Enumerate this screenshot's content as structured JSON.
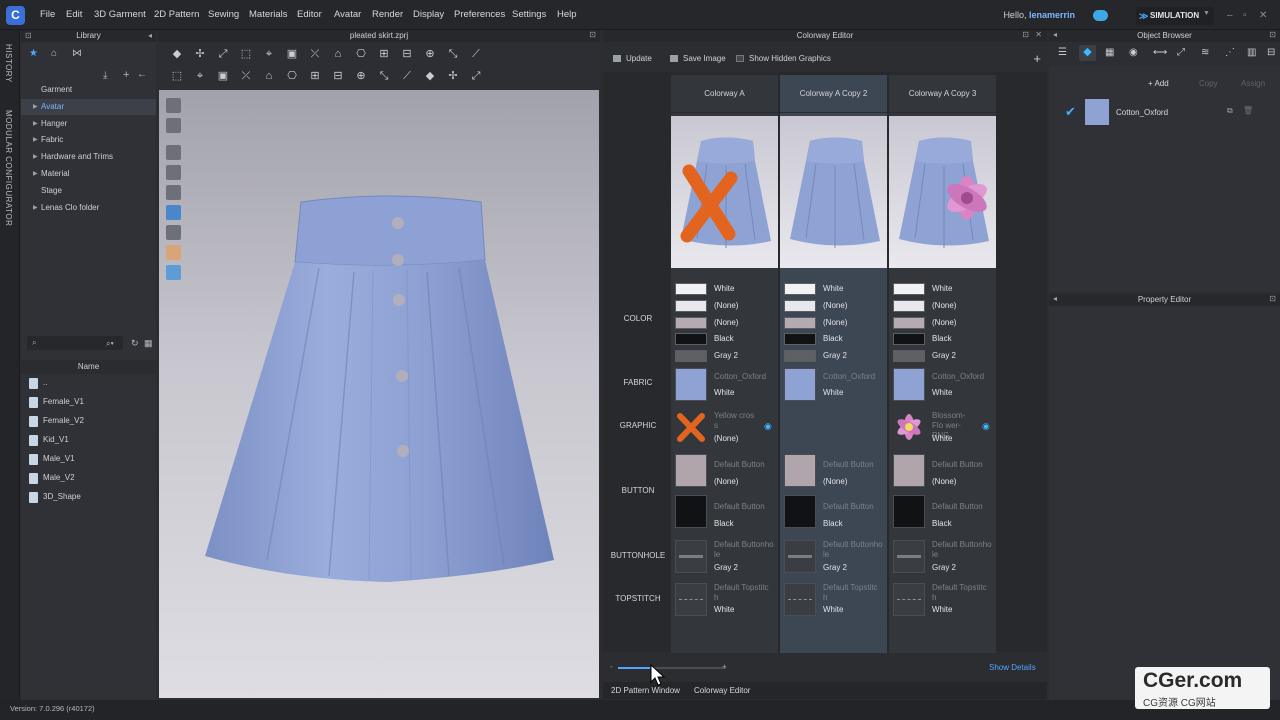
{
  "app": {
    "menus": [
      "File",
      "Edit",
      "3D Garment",
      "2D Pattern",
      "Sewing",
      "Materials",
      "Editor",
      "Avatar",
      "Render",
      "Display",
      "Preferences",
      "Settings",
      "Help"
    ],
    "greeting": "Hello,",
    "username": "lenamerrin",
    "mode": "SIMULATION",
    "logo": "C"
  },
  "side_tabs": [
    "HISTORY",
    "MODULAR CONFIGURATOR"
  ],
  "library": {
    "title": "Library",
    "tree": [
      {
        "label": "Garment",
        "arrow": false,
        "selected": false
      },
      {
        "label": "Avatar",
        "arrow": true,
        "selected": true
      },
      {
        "label": "Hanger",
        "arrow": true,
        "selected": false
      },
      {
        "label": "Fabric",
        "arrow": true,
        "selected": false
      },
      {
        "label": "Hardware and Trims",
        "arrow": true,
        "selected": false
      },
      {
        "label": "Material",
        "arrow": true,
        "selected": false
      },
      {
        "label": "Stage",
        "arrow": false,
        "selected": false
      },
      {
        "label": "Lenas Clo folder",
        "arrow": true,
        "selected": false
      }
    ],
    "search_placeholder": "Q",
    "name_header": "Name",
    "files": [
      "..",
      "Female_V1",
      "Female_V2",
      "Kid_V1",
      "Male_V1",
      "Male_V2",
      "3D_Shape"
    ]
  },
  "viewport": {
    "title": "pleated skirt.zprj"
  },
  "colorway": {
    "title": "Colorway Editor",
    "actions": [
      "Update",
      "Save Image",
      "Show Hidden Graphics"
    ],
    "columns": [
      {
        "name": "Colorway A",
        "graphic": "cross",
        "colors": [
          "White",
          "(None)",
          "(None)",
          "Black",
          "Gray 2"
        ],
        "fabric_name": "Cotton_Oxford",
        "fabric_color": "White",
        "graphic_name": "Yellow cros s",
        "graphic_color": "(None)",
        "button1_name": "Default Button",
        "button1_color": "(None)",
        "button2_name": "Default Button",
        "button2_color": "Black",
        "buttonhole_name": "Default Buttonho le",
        "buttonhole_color": "Gray 2",
        "topstitch_name": "Default Topstitc h",
        "topstitch_color": "White"
      },
      {
        "name": "Colorway A Copy 2",
        "graphic": "none",
        "colors": [
          "White",
          "(None)",
          "(None)",
          "Black",
          "Gray 2"
        ],
        "fabric_name": "Cotton_Oxford",
        "fabric_color": "White",
        "graphic_name": "",
        "graphic_color": "",
        "button1_name": "Default Button",
        "button1_color": "(None)",
        "button2_name": "Default Button",
        "button2_color": "Black",
        "buttonhole_name": "Default Buttonho le",
        "buttonhole_color": "Gray 2",
        "topstitch_name": "Default Topstitc h",
        "topstitch_color": "White"
      },
      {
        "name": "Colorway A Copy 3",
        "graphic": "flower",
        "colors": [
          "White",
          "(None)",
          "(None)",
          "Black",
          "Gray 2"
        ],
        "fabric_name": "Cotton_Oxford",
        "fabric_color": "White",
        "graphic_name": "Blossom-Flo wer-PNG",
        "graphic_color": "White",
        "button1_name": "Default Button",
        "button1_color": "(None)",
        "button2_name": "Default Button",
        "button2_color": "Black",
        "buttonhole_name": "Default Buttonho le",
        "buttonhole_color": "Gray 2",
        "topstitch_name": "Default Topstitc h",
        "topstitch_color": "White"
      }
    ],
    "row_labels": [
      "COLOR",
      "FABRIC",
      "GRAPHIC",
      "BUTTON",
      "BUTTONHOLE",
      "TOPSTITCH"
    ],
    "zoom_minus": "-",
    "zoom_plus": "+",
    "show_details": "Show Details"
  },
  "bottom_tabs": [
    "2D Pattern Window",
    "Colorway Editor"
  ],
  "object_browser": {
    "title": "Object Browser",
    "add": "+ Add",
    "copy": "Copy",
    "assign": "Assign",
    "items": [
      {
        "name": "Cotton_Oxford",
        "checked": true
      }
    ]
  },
  "property_editor": {
    "title": "Property Editor"
  },
  "status": {
    "version": "Version: 7.0.296 (r40172)"
  },
  "watermark": {
    "main": "CGer.com",
    "sub": "CG资源 CG网站"
  },
  "colors": {
    "fabric_blue": "#8fa2d4",
    "accent": "#4ea6ff",
    "cross_orange": "#e3641e",
    "flower_pink": "#d884c6"
  }
}
